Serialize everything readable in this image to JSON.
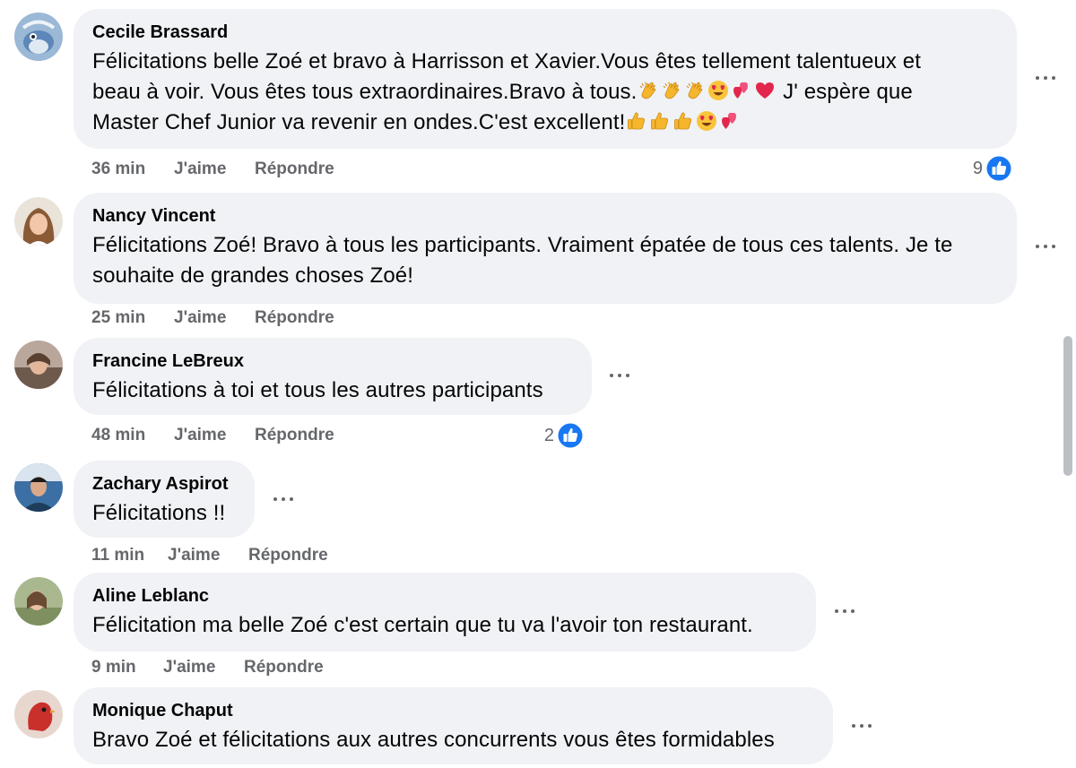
{
  "comments": [
    {
      "author": "Cecile Brassard",
      "text_1": "Félicitations belle Zoé et bravo à Harrisson et Xavier.Vous êtes tellement talentueux et",
      "text_2": "beau à voir. Vous êtes tous extraordinaires.Bravo à tous.",
      "text_2b": " J' espère que",
      "text_3": "Master Chef Junior va revenir en ondes.C'est excellent!",
      "time": "36 min",
      "like_label": "J'aime",
      "reply_label": "Répondre",
      "reaction_count": "9"
    },
    {
      "author": "Nancy Vincent",
      "text_1": "Félicitations Zoé! Bravo à tous les participants. Vraiment épatée de tous ces talents. Je te",
      "text_2": "souhaite de grandes choses Zoé!",
      "time": "25 min",
      "like_label": "J'aime",
      "reply_label": "Répondre"
    },
    {
      "author": "Francine LeBreux",
      "text_1": "Félicitations à toi et tous les autres participants",
      "time": "48 min",
      "like_label": "J'aime",
      "reply_label": "Répondre",
      "reaction_count": "2"
    },
    {
      "author": "Zachary Aspirot",
      "text_1": "Félicitations !!",
      "time": "11 min",
      "like_label": "J'aime",
      "reply_label": "Répondre"
    },
    {
      "author": "Aline Leblanc",
      "text_1": "Félicitation ma belle Zoé c'est certain que tu va l'avoir ton restaurant.",
      "time": "9 min",
      "like_label": "J'aime",
      "reply_label": "Répondre"
    },
    {
      "author": "Monique Chaput",
      "text_1": "Bravo Zoé et félicitations aux autres concurrents vous êtes formidables"
    }
  ],
  "icons": {
    "more": "more-options-icon",
    "like": "like-reaction-icon",
    "clap": "clapping-hands-emoji",
    "heart_eyes": "heart-eyes-emoji",
    "two_hearts": "two-hearts-emoji",
    "red_heart": "red-heart-emoji",
    "thumbs_up": "thumbs-up-emoji"
  },
  "colors": {
    "bubble": "#f0f2f5",
    "meta_text": "#65676b",
    "like_blue": "#1877f2"
  }
}
